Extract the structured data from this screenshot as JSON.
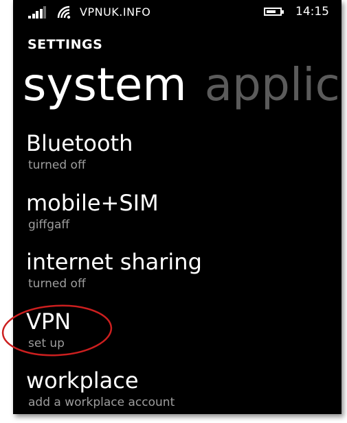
{
  "status_bar": {
    "label": "VPNUK.INFO",
    "time": "14:15",
    "signal_icon": "signal-strength-icon",
    "wifi_icon": "wifi-icon",
    "battery_icon": "battery-icon",
    "signal_bars_active": 4,
    "signal_bars_total": 5,
    "battery_level": 0.7
  },
  "header": {
    "app_title": "SETTINGS"
  },
  "pivot": {
    "active": "system",
    "inactive": "applicat"
  },
  "settings": [
    {
      "title": "Bluetooth",
      "subtitle": "turned off"
    },
    {
      "title": "mobile+SIM",
      "subtitle": "giffgaff"
    },
    {
      "title": "internet sharing",
      "subtitle": "turned off"
    },
    {
      "title": "VPN",
      "subtitle": "set up"
    },
    {
      "title": "workplace",
      "subtitle": "add a workplace account"
    }
  ],
  "colors": {
    "background": "#000000",
    "text": "#ffffff",
    "subtext": "#9e9e9e",
    "pivot_inactive": "#5b5b5b",
    "annotation_circle": "#cc1f1f"
  }
}
